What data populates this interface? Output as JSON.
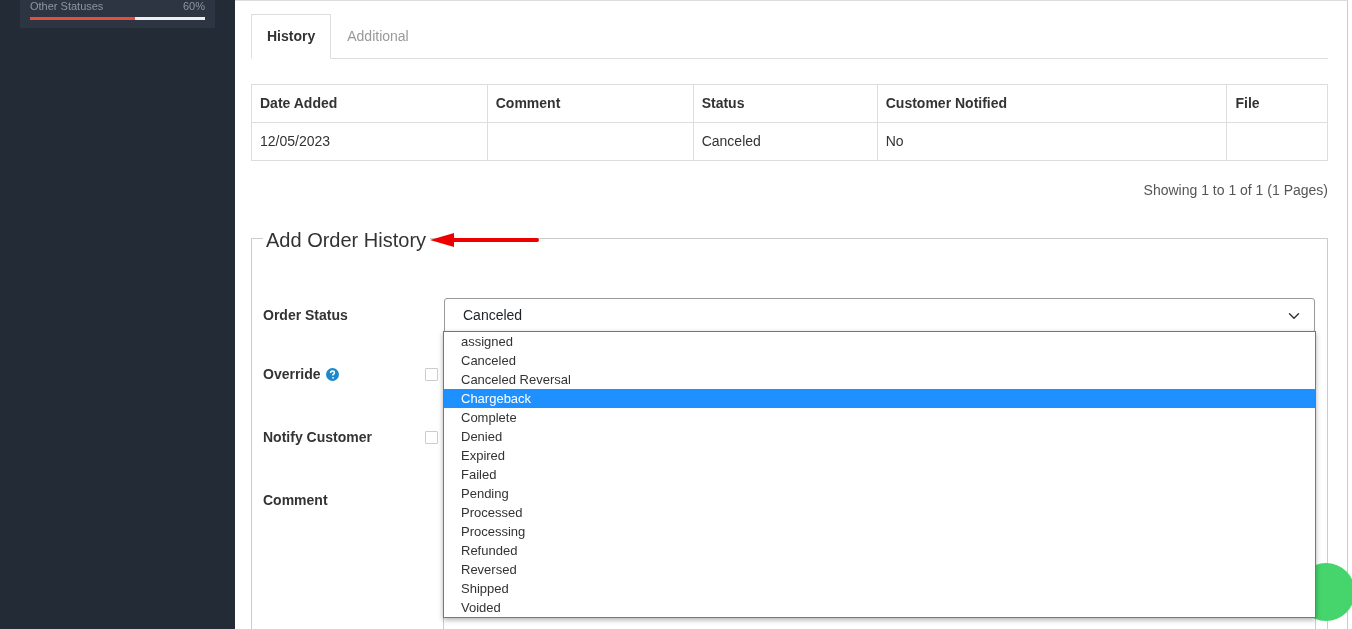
{
  "sidebar": {
    "status_progress": {
      "label": "Other Statuses",
      "value": "60%",
      "level": 0.6
    }
  },
  "tabs": [
    {
      "label": "History",
      "selected": true
    },
    {
      "label": "Additional",
      "selected": false
    }
  ],
  "history_table": {
    "columns": [
      "Date Added",
      "Comment",
      "Status",
      "Customer Notified",
      "File"
    ],
    "rows": [
      [
        "12/05/2023",
        "",
        "Canceled",
        "No",
        ""
      ]
    ]
  },
  "pagination_text": "Showing 1 to 1 of 1 (1 Pages)",
  "add_history": {
    "legend": "Add Order History",
    "order_status": {
      "label": "Order Status",
      "value": "Canceled",
      "expanded": true,
      "options": [
        {
          "label": "assigned",
          "highlighted": false
        },
        {
          "label": "Canceled",
          "highlighted": false
        },
        {
          "label": "Canceled Reversal",
          "highlighted": false
        },
        {
          "label": "Chargeback",
          "highlighted": true
        },
        {
          "label": "Complete",
          "highlighted": false
        },
        {
          "label": "Denied",
          "highlighted": false
        },
        {
          "label": "Expired",
          "highlighted": false
        },
        {
          "label": "Failed",
          "highlighted": false
        },
        {
          "label": "Pending",
          "highlighted": false
        },
        {
          "label": "Processed",
          "highlighted": false
        },
        {
          "label": "Processing",
          "highlighted": false
        },
        {
          "label": "Refunded",
          "highlighted": false
        },
        {
          "label": "Reversed",
          "highlighted": false
        },
        {
          "label": "Shipped",
          "highlighted": false
        },
        {
          "label": "Voided",
          "highlighted": false
        }
      ]
    },
    "override": {
      "label": "Override",
      "checked": false
    },
    "notify_customer": {
      "label": "Notify Customer",
      "checked": false
    },
    "comment": {
      "label": "Comment"
    }
  }
}
